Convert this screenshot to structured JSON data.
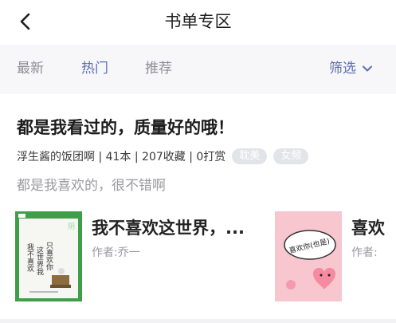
{
  "header": {
    "title": "书单专区",
    "back_icon": "chevron-left-icon"
  },
  "tabs": [
    {
      "label": "最新",
      "active": false
    },
    {
      "label": "热门",
      "active": true
    },
    {
      "label": "推荐",
      "active": false
    }
  ],
  "filter": {
    "label": "筛选",
    "icon": "chevron-down-icon"
  },
  "booklist": {
    "title": "都是我看过的，质量好的哦！",
    "meta": "浮生酱的饭团啊 | 41本 | 207收藏 | 0打赏",
    "tags": [
      "耽美",
      "女频"
    ],
    "description": "都是我喜欢的，很不错啊"
  },
  "books": [
    {
      "title": "我不喜欢这世界，...",
      "author": "作者:乔一",
      "cover_text": "我不喜欢这世界我只喜欢你"
    },
    {
      "title": "喜欢",
      "author": "作者:",
      "cover_text": "喜欢你(也是)"
    }
  ],
  "colors": {
    "accent": "#5b6fb0",
    "tabs_bg": "#f7f7f9",
    "tag_bg": "#e3e4e8",
    "cover_green": "#3f9f49",
    "cover_pink": "#f7c6cf"
  }
}
